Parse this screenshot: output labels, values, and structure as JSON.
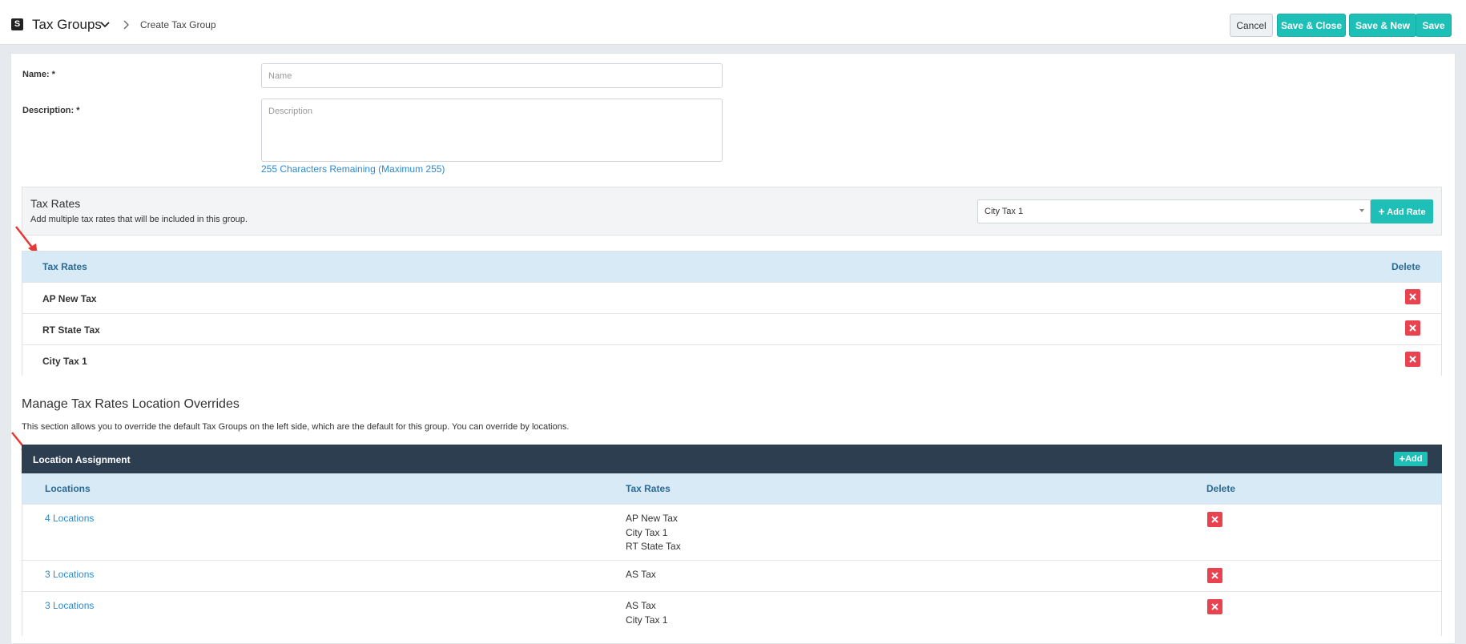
{
  "header": {
    "logo": "S",
    "title": "Tax Groups",
    "breadcrumb": "Create Tax Group",
    "buttons": {
      "cancel": "Cancel",
      "save_close": "Save & Close",
      "save_new": "Save & New",
      "save": "Save"
    }
  },
  "form": {
    "name_label": "Name: *",
    "name_placeholder": "Name",
    "description_label": "Description: *",
    "description_placeholder": "Description",
    "remaining": "255 Characters Remaining (Maximum 255)"
  },
  "tax_rates_section": {
    "title": "Tax Rates",
    "subtitle": "Add multiple tax rates that will be included in this group.",
    "selected": "City Tax 1",
    "add_button": "Add Rate"
  },
  "tax_rates_table": {
    "columns": [
      "Tax Rates",
      "Delete"
    ],
    "rows": [
      "AP New Tax",
      "RT State Tax",
      "City Tax 1"
    ]
  },
  "overrides": {
    "title": "Manage Tax Rates Location Overrides",
    "description": "This section allows you to override the default Tax Groups on the left side, which are the default for this group. You can override by locations.",
    "panel_title": "Location Assignment",
    "add_button": "Add",
    "columns": [
      "Locations",
      "Tax Rates",
      "Delete"
    ],
    "rows": [
      {
        "locations": "4 Locations",
        "rates": [
          "AP New Tax",
          "City Tax 1",
          "RT State Tax"
        ]
      },
      {
        "locations": "3 Locations",
        "rates": [
          "AS Tax"
        ]
      },
      {
        "locations": "3 Locations",
        "rates": [
          "AS Tax",
          "City Tax 1"
        ]
      }
    ]
  },
  "colors": {
    "accent": "#1ebfb6",
    "delete": "#e8434f",
    "table_header": "#d7eaf5",
    "dark_header": "#2c3e50",
    "link": "#2a8ad4"
  }
}
